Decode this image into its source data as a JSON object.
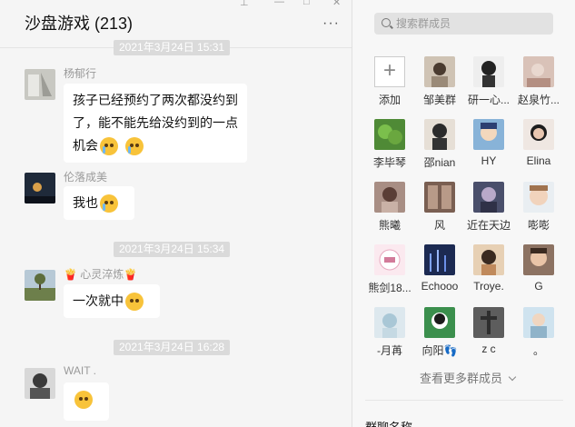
{
  "chat": {
    "title": "沙盘游戏 (213)",
    "more_label": "···",
    "timestamps": [
      "2021年3月24日 15:31",
      "2021年3月24日 15:34",
      "2021年3月24日 16:28"
    ],
    "messages": [
      {
        "sender": "杨郁行",
        "line1": "孩子已经预约了两次都没约到",
        "line2": "了，能不能先给没约到的一点",
        "line3": "机会"
      },
      {
        "sender": "伦落成美",
        "text": "我也"
      },
      {
        "sender": "心灵淬炼",
        "text": "一次就中"
      },
      {
        "sender": "WAIT ."
      }
    ]
  },
  "panel": {
    "search": {
      "placeholder": "搜索群成员"
    },
    "members": [
      {
        "name": "添加"
      },
      {
        "name": "邹美群"
      },
      {
        "name": "研一心..."
      },
      {
        "name": "赵泉竹..."
      },
      {
        "name": "李毕琴"
      },
      {
        "name": "邵nian"
      },
      {
        "name": "HY"
      },
      {
        "name": "Elina"
      },
      {
        "name": "熊曦"
      },
      {
        "name": "风"
      },
      {
        "name": "近在天边"
      },
      {
        "name": "嘭嘭"
      },
      {
        "name": "熊剑18..."
      },
      {
        "name": "Echooo"
      },
      {
        "name": "Troye."
      },
      {
        "name": "G"
      },
      {
        "name": "-月苒"
      },
      {
        "name": "向阳👣"
      },
      {
        "name": "z c"
      },
      {
        "name": "。"
      }
    ],
    "view_more": "查看更多群成员",
    "section_title": "群聊名称"
  },
  "colors": {
    "bubble": "#ffffff",
    "timestamp_bg": "#dadada",
    "chat_bg": "#f5f5f5"
  }
}
